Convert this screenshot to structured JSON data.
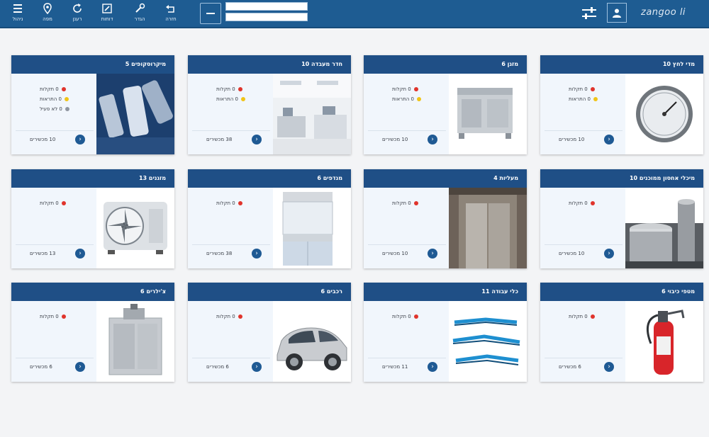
{
  "toolbar": {
    "items": [
      {
        "label": "ניהול",
        "icon": "list-icon"
      },
      {
        "label": "מפה",
        "icon": "map-pin-icon"
      },
      {
        "label": "רענן",
        "icon": "refresh-icon"
      },
      {
        "label": "דוחות",
        "icon": "edit-icon"
      },
      {
        "label": "הגדר",
        "icon": "tools-icon"
      },
      {
        "label": "חזרה",
        "icon": "undo-icon"
      }
    ],
    "menu_icon": "menu-icon",
    "search_placeholder": "",
    "filter_placeholder": "",
    "logo": "zangoo li",
    "user_icon": "user-icon",
    "settings_icon": "sliders-icon"
  },
  "colors": {
    "topbar": "#1e5c92",
    "card_header": "#1f4f86",
    "alert_red": "#e0342c",
    "alert_yellow": "#f0c418"
  },
  "cards": [
    {
      "title": "מיקרוסקופים 5",
      "image": "microscope-icon",
      "stats": [
        {
          "color": "red",
          "text": "0 תקלות"
        },
        {
          "color": "yellow",
          "text": "0 התראות"
        },
        {
          "color": "gray",
          "text": "0 לא פעיל"
        }
      ],
      "footer": "10 מכשירים"
    },
    {
      "title": "חדר מעבדה 10",
      "image": "lab-room-icon",
      "stats": [
        {
          "color": "red",
          "text": "0 תקלות"
        },
        {
          "color": "yellow",
          "text": "0 התראות"
        }
      ],
      "footer": "38 מכשירים"
    },
    {
      "title": "מזגן 6",
      "image": "hvac-unit-icon",
      "stats": [
        {
          "color": "red",
          "text": "0 תקלות"
        },
        {
          "color": "yellow",
          "text": "0 התראות"
        }
      ],
      "footer": "10 מכשירים"
    },
    {
      "title": "מדי לחץ 10",
      "image": "gauge-icon",
      "stats": [
        {
          "color": "red",
          "text": "0 תקלות"
        },
        {
          "color": "yellow",
          "text": "0 התראות"
        }
      ],
      "footer": "10 מכשירים"
    },
    {
      "title": "מזגנים 13",
      "image": "air-conditioner-icon",
      "stats": [
        {
          "color": "red",
          "text": "0 תקלות"
        }
      ],
      "footer": "13 מכשירים"
    },
    {
      "title": "מנדפים 6",
      "image": "fume-hood-icon",
      "stats": [
        {
          "color": "red",
          "text": "0 תקלות"
        }
      ],
      "footer": "38 מכשירים"
    },
    {
      "title": "מעליות 4",
      "image": "elevator-icon",
      "stats": [
        {
          "color": "red",
          "text": "0 תקלות"
        }
      ],
      "footer": "10 מכשירים"
    },
    {
      "title": "מיכלי אחסון ממוכנים 10",
      "image": "silo-icon",
      "stats": [
        {
          "color": "red",
          "text": "0 תקלות"
        }
      ],
      "footer": "10 מכשירים"
    },
    {
      "title": "צ'ילרים 6",
      "image": "chiller-icon",
      "stats": [
        {
          "color": "red",
          "text": "0 תקלות"
        }
      ],
      "footer": "6 מכשירים"
    },
    {
      "title": "רכבים 6",
      "image": "car-icon",
      "stats": [
        {
          "color": "red",
          "text": "0 תקלות"
        }
      ],
      "footer": "6 מכשירים"
    },
    {
      "title": "כלי עבודה 11",
      "image": "pliers-icon",
      "stats": [
        {
          "color": "red",
          "text": "0 תקלות"
        }
      ],
      "footer": "11 מכשירים"
    },
    {
      "title": "מטפי כיבוי 6",
      "image": "fire-extinguisher-icon",
      "stats": [
        {
          "color": "red",
          "text": "0 תקלות"
        }
      ],
      "footer": "6 מכשירים"
    }
  ]
}
